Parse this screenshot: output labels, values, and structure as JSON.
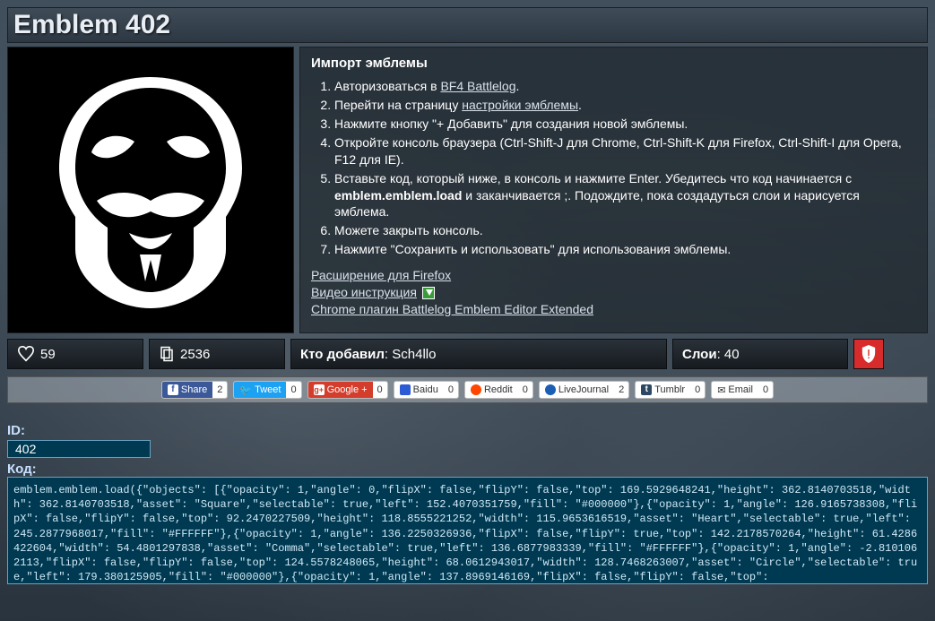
{
  "title": "Emblem 402",
  "instructions": {
    "heading": "Импорт эмблемы",
    "steps": [
      {
        "pre": "Авторизоваться в ",
        "link": "BF4 Battlelog",
        "post": "."
      },
      {
        "pre": "Перейти на страницу ",
        "link": "настройки эмблемы",
        "post": "."
      },
      {
        "text": "Нажмите кнопку \"+ Добавить\" для создания новой эмблемы."
      },
      {
        "text": "Откройте консоль браузера (Ctrl-Shift-J для Chrome, Ctrl-Shift-K для Firefox, Ctrl-Shift-I для Opera, F12 для IE)."
      },
      {
        "pre": "Вставьте код, который ниже, в консоль и нажмите Enter. Убедитесь что код начинается с ",
        "bold": "emblem.emblem.load",
        "post": " и заканчивается ;. Подождите, пока создадуться слои и нарисуется эмблема."
      },
      {
        "text": "Можете закрыть консоль."
      },
      {
        "text": "Нажмите \"Сохранить и использовать\" для использования эмблемы."
      }
    ],
    "extLinks": {
      "firefox": "Расширение для Firefox",
      "video": "Видео инструкция",
      "chrome": "Chrome плагин Battlelog Emblem Editor Extended"
    }
  },
  "stats": {
    "likes": "59",
    "copies": "2536",
    "authorLabel": "Кто добавил",
    "authorValue": "Sch4llo",
    "layersLabel": "Слои",
    "layersValue": "40"
  },
  "share": {
    "facebook": {
      "label": "Share",
      "count": "2"
    },
    "twitter": {
      "label": "Tweet",
      "count": "0"
    },
    "google": {
      "label": "Google +",
      "count": "0"
    },
    "baidu": {
      "label": "Baidu",
      "count": "0"
    },
    "reddit": {
      "label": "Reddit",
      "count": "0"
    },
    "livejournal": {
      "label": "LiveJournal",
      "count": "2"
    },
    "tumblr": {
      "label": "Tumblr",
      "count": "0"
    },
    "email": {
      "label": "Email",
      "count": "0"
    }
  },
  "idLabel": "ID:",
  "idValue": "402",
  "codeLabel": "Код:",
  "codeValue": "emblem.emblem.load({\"objects\": [{\"opacity\": 1,\"angle\": 0,\"flipX\": false,\"flipY\": false,\"top\": 169.5929648241,\"height\": 362.8140703518,\"width\": 362.8140703518,\"asset\": \"Square\",\"selectable\": true,\"left\": 152.4070351759,\"fill\": \"#000000\"},{\"opacity\": 1,\"angle\": 126.9165738308,\"flipX\": false,\"flipY\": false,\"top\": 92.2470227509,\"height\": 118.8555221252,\"width\": 115.9653616519,\"asset\": \"Heart\",\"selectable\": true,\"left\": 245.2877968017,\"fill\": \"#FFFFFF\"},{\"opacity\": 1,\"angle\": 136.2250326936,\"flipX\": false,\"flipY\": true,\"top\": 142.2178570264,\"height\": 61.4286422604,\"width\": 54.4801297838,\"asset\": \"Comma\",\"selectable\": true,\"left\": 136.6877983339,\"fill\": \"#FFFFFF\"},{\"opacity\": 1,\"angle\": -2.8101062113,\"flipX\": false,\"flipY\": false,\"top\": 124.5578248065,\"height\": 68.0612943017,\"width\": 128.7468263007,\"asset\": \"Circle\",\"selectable\": true,\"left\": 179.380125905,\"fill\": \"#000000\"},{\"opacity\": 1,\"angle\": 137.8969146169,\"flipX\": false,\"flipY\": false,\"top\":"
}
